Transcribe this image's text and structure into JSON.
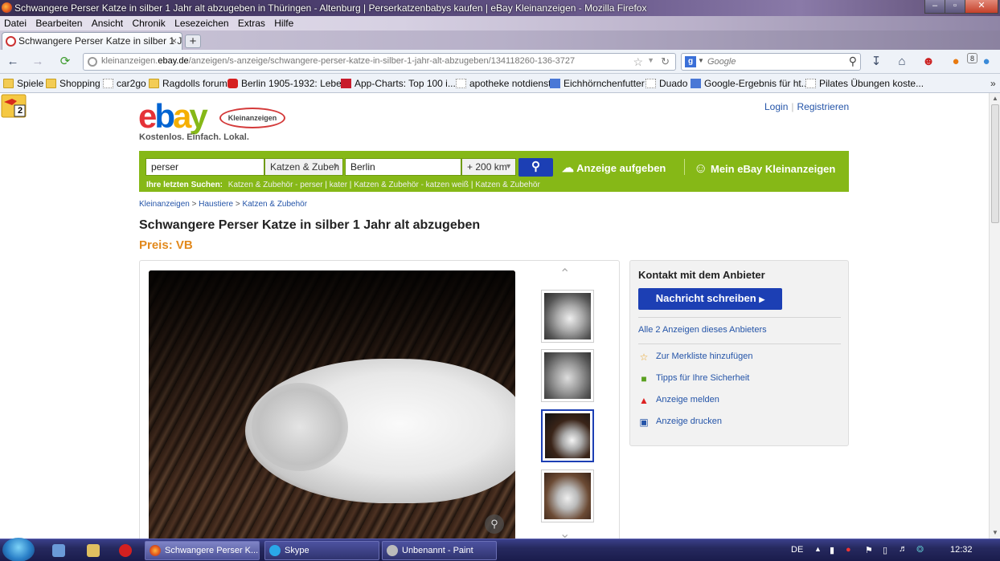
{
  "window": {
    "title": "Schwangere Perser Katze in silber 1 Jahr alt abzugeben in Thüringen - Altenburg | Perserkatzenbabys kaufen | eBay Kleinanzeigen - Mozilla Firefox",
    "menu": [
      "Datei",
      "Bearbeiten",
      "Ansicht",
      "Chronik",
      "Lesezeichen",
      "Extras",
      "Hilfe"
    ],
    "controls": {
      "minimize": "–",
      "maximize": "▫",
      "close": "✕"
    }
  },
  "browser": {
    "tab_title": "Schwangere Perser Katze in silber 1 Jahr ...",
    "tab_close": "×",
    "new_tab": "+",
    "url_pre": "kleinanzeigen.",
    "url_domain": "ebay.de",
    "url_post": "/anzeigen/s-anzeige/schwangere-perser-katze-in-silber-1-jahr-alt-abzugeben/134118260-136-3727",
    "search_engine": "g",
    "search_placeholder": "Google",
    "addon_count": "2",
    "notif_count": "8",
    "bookmarks": [
      {
        "label": "Spiele",
        "icon": "folder-icon"
      },
      {
        "label": "Shopping",
        "icon": "folder-icon"
      },
      {
        "label": "car2go",
        "icon": "page-icon"
      },
      {
        "label": "Ragdolls forum",
        "icon": "folder-icon"
      },
      {
        "label": "Berlin 1905-1932: Lebe...",
        "icon": "youtube-icon"
      },
      {
        "label": "App-Charts: Top 100 i...",
        "icon": "app-charts-icon"
      },
      {
        "label": "apotheke notdienst",
        "icon": "page-icon"
      },
      {
        "label": "Eichhörnchenfutter",
        "icon": "google-icon"
      },
      {
        "label": "Duado",
        "icon": "page-icon"
      },
      {
        "label": "Google-Ergebnis für ht...",
        "icon": "google-icon"
      },
      {
        "label": "Pilates Übungen koste...",
        "icon": "page-icon"
      }
    ]
  },
  "page": {
    "logo_text": "ebay",
    "logo_badge": "Kleinanzeigen",
    "slogan": "Kostenlos. Einfach. Lokal.",
    "login": "Login",
    "register": "Registrieren",
    "search": {
      "query": "perser",
      "category": "Katzen & Zubeh",
      "location": "Berlin",
      "radius": "+ 200 km",
      "post_ad": "Anzeige aufgeben",
      "my_ebay": "Mein eBay Kleinanzeigen",
      "recent_label": "Ihre letzten Suchen:",
      "recent": [
        "Katzen & Zubehör - perser",
        "kater",
        "Katzen & Zubehör - katzen weiß",
        "Katzen & Zubehör"
      ]
    },
    "breadcrumb": [
      "Kleinanzeigen",
      "Haustiere",
      "Katzen & Zubehör"
    ],
    "title": "Schwangere Perser Katze in silber 1 Jahr alt abzugeben",
    "price": "Preis: VB",
    "contact": {
      "heading": "Kontakt mit dem Anbieter",
      "message_button": "Nachricht schreiben",
      "all_ads": "Alle 2 Anzeigen dieses Anbieters",
      "watchlist": "Zur Merkliste hinzufügen",
      "safety": "Tipps für Ihre Sicherheit",
      "report": "Anzeige melden",
      "print": "Anzeige drucken"
    }
  },
  "taskbar": {
    "tasks": [
      "Schwangere Perser K...",
      "Skype",
      "Unbenannt - Paint"
    ],
    "language": "DE",
    "clock": "12:32"
  },
  "colors": {
    "ebay_green": "#86b817",
    "ebay_blue": "#1c3fb4",
    "price_orange": "#e2891c",
    "link_blue": "#2454a8"
  }
}
